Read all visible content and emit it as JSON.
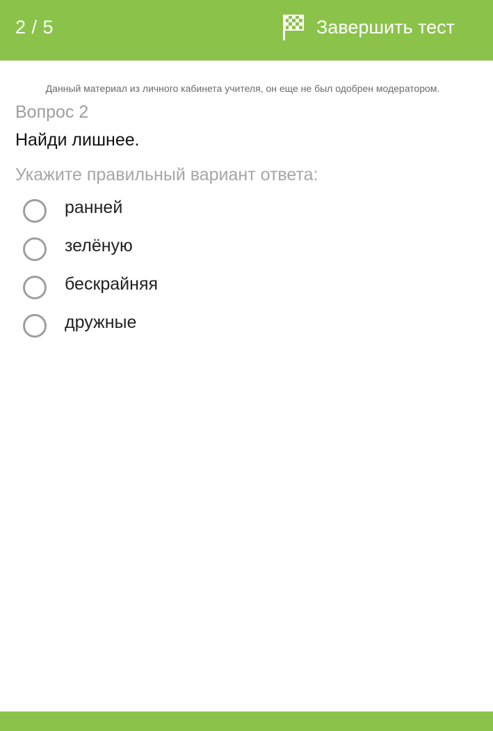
{
  "header": {
    "counter": "2 / 5",
    "finish_label": "Завершить тест",
    "finish_icon": "checkered-flag-icon",
    "background_color": "#8bc34a"
  },
  "notice": "Данный материал из личного кабинета учителя, он еще не был одобрен модератором.",
  "question": {
    "number_label": "Вопрос 2",
    "text": "Найди лишнее.",
    "instruction": "Укажите правильный вариант ответа:",
    "options": [
      {
        "label": "ранней",
        "selected": false
      },
      {
        "label": "зелёную",
        "selected": false
      },
      {
        "label": "бескрайняя",
        "selected": false
      },
      {
        "label": "дружные",
        "selected": false
      }
    ]
  },
  "footer": {
    "background_color": "#8bc34a"
  }
}
